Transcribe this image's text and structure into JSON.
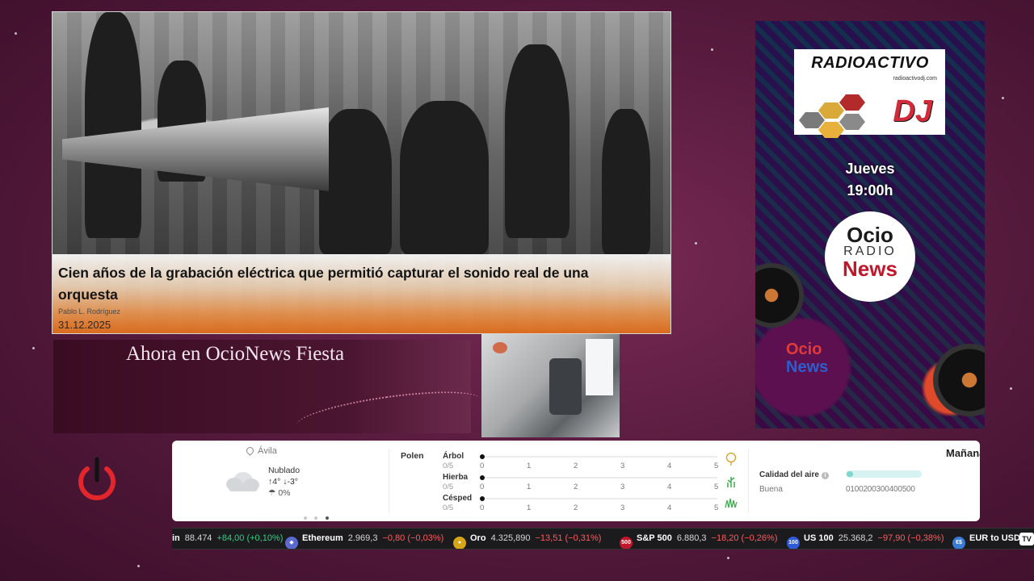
{
  "news": {
    "title": "Cien años de la grabación eléctrica que permitió capturar el sonido real de una orquesta",
    "author": "Pablo L. Rodríguez",
    "date": "31.12.2025"
  },
  "now_playing": {
    "text": "Ahora en OcioNews Fiesta"
  },
  "radio_banner": {
    "logo_title": "RADIOACTIVO",
    "logo_url": "radioactivodj.com",
    "logo_dj": "DJ",
    "day": "Jueves",
    "time": "19:00h",
    "ocio_line1": "Ocio",
    "ocio_line2": "RADIO",
    "ocio_line3": "News",
    "mini_logo_line1": "Ocio",
    "mini_logo_line2": "News"
  },
  "weather": {
    "location": "Ávila",
    "condition": "Nublado",
    "temp_high": "4°",
    "temp_low": "-3°",
    "precipitation": "0%",
    "pollen_title": "Polen",
    "pollen": [
      {
        "name": "Árbol",
        "value": "0/5",
        "level": 0
      },
      {
        "name": "Hierba",
        "value": "0/5",
        "level": 0
      },
      {
        "name": "Césped",
        "value": "0/5",
        "level": 0
      }
    ],
    "pollen_ticks": [
      "0",
      "1",
      "2",
      "3",
      "4",
      "5"
    ],
    "air_quality_label": "Calidad del aire",
    "air_quality_status": "Buena",
    "air_quality_scale": "0100200300400500",
    "tomorrow_label": "Mañana",
    "carousel_active_index": 2
  },
  "ticker": [
    {
      "symbol": "in",
      "value": "88.474",
      "change": "+84,00 (+0,10%)",
      "trend": "pos",
      "badge": ""
    },
    {
      "symbol": "Ethereum",
      "value": "2.969,3",
      "change": "−0,80 (−0,03%)",
      "trend": "neg",
      "badge": "◆"
    },
    {
      "symbol": "Oro",
      "value": "4.325,890",
      "change": "−13,51 (−0,31%)",
      "trend": "neg",
      "badge": "●"
    },
    {
      "symbol": "S&P 500",
      "value": "6.880,3",
      "change": "−18,20 (−0,26%)",
      "trend": "neg",
      "badge": "500"
    },
    {
      "symbol": "US 100",
      "value": "25.368,2",
      "change": "−97,90 (−0,38%)",
      "trend": "neg",
      "badge": "100"
    },
    {
      "symbol": "EUR to USD",
      "value": "",
      "change": "",
      "trend": "pos",
      "badge": "€$"
    }
  ],
  "ticker_logo": "TV",
  "colors": {
    "background": "#5a1c40",
    "accent_orange": "#e26e1e",
    "positive": "#2fcf84",
    "negative": "#ff5a5f",
    "power_red": "#e3262c"
  }
}
